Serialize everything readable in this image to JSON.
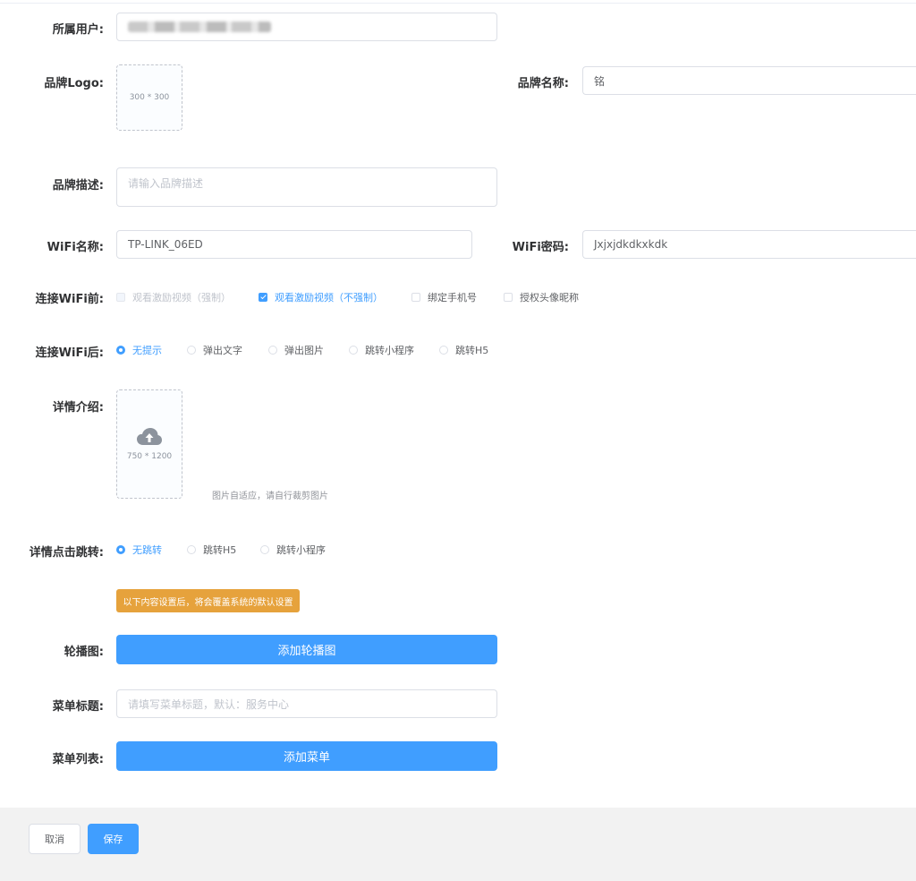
{
  "form": {
    "owner_user": {
      "label": "所属用户:"
    },
    "brand_logo": {
      "label": "品牌Logo:",
      "upload_hint": "300 * 300"
    },
    "brand_name": {
      "label": "品牌名称:",
      "value": "铭"
    },
    "brand_desc": {
      "label": "品牌描述:",
      "placeholder": "请输入品牌描述"
    },
    "wifi_name": {
      "label": "WiFi名称:",
      "value": "TP-LINK_06ED"
    },
    "wifi_password": {
      "label": "WiFi密码:",
      "value": "Jxjxjdkdkxkdk"
    },
    "before_connect": {
      "label": "连接WiFi前:",
      "options": [
        {
          "label": "观看激励视频（强制）",
          "state": "disabled"
        },
        {
          "label": "观看激励视频（不强制）",
          "state": "checked"
        },
        {
          "label": "绑定手机号",
          "state": "unchecked"
        },
        {
          "label": "授权头像昵称",
          "state": "unchecked"
        }
      ]
    },
    "after_connect": {
      "label": "连接WiFi后:",
      "options": [
        {
          "label": "无提示",
          "selected": true
        },
        {
          "label": "弹出文字",
          "selected": false
        },
        {
          "label": "弹出图片",
          "selected": false
        },
        {
          "label": "跳转小程序",
          "selected": false
        },
        {
          "label": "跳转H5",
          "selected": false
        }
      ]
    },
    "detail_intro": {
      "label": "详情介绍:",
      "upload_hint": "750 * 1200",
      "tip": "图片自适应，请自行裁剪图片"
    },
    "detail_jump": {
      "label": "详情点击跳转:",
      "options": [
        {
          "label": "无跳转",
          "selected": true
        },
        {
          "label": "跳转H5",
          "selected": false
        },
        {
          "label": "跳转小程序",
          "selected": false
        }
      ]
    },
    "override_notice": "以下内容设置后，将会覆盖系统的默认设置",
    "carousel": {
      "label": "轮播图:",
      "button": "添加轮播图"
    },
    "menu_title": {
      "label": "菜单标题:",
      "placeholder": "请填写菜单标题，默认：服务中心"
    },
    "menu_list": {
      "label": "菜单列表:",
      "button": "添加菜单"
    }
  },
  "footer": {
    "cancel": "取消",
    "save": "保存"
  },
  "colors": {
    "primary": "#409eff",
    "warning": "#e6a23c",
    "footer_bg": "#f2f2f2"
  },
  "icons": {
    "upload": "cloud-upload-icon"
  }
}
